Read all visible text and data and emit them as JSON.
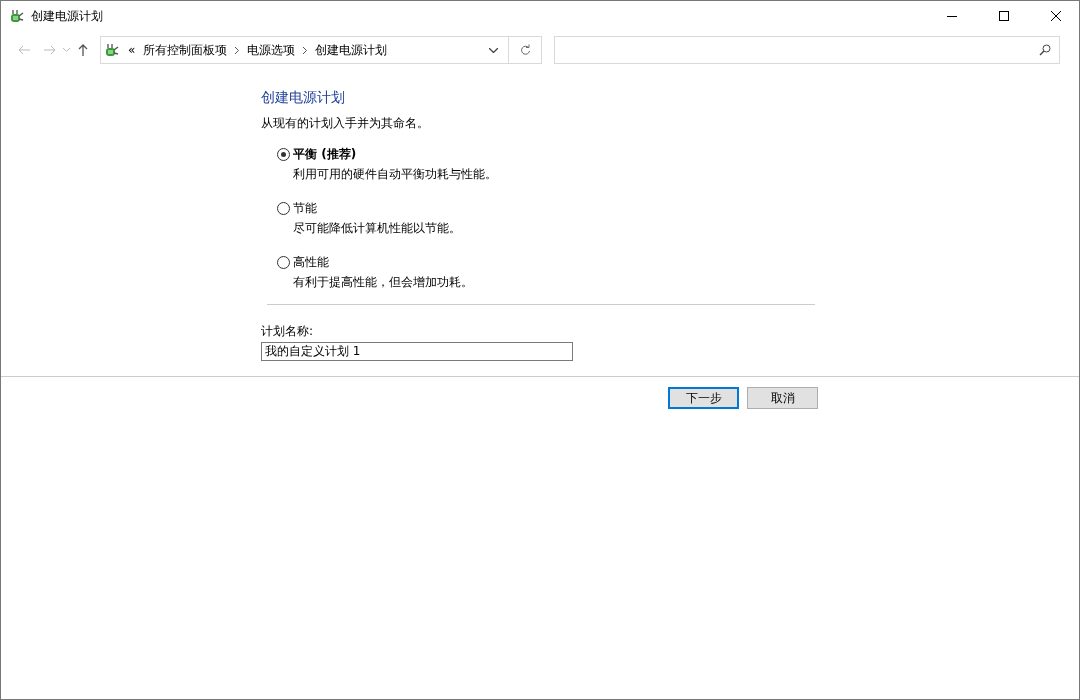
{
  "window": {
    "title": "创建电源计划"
  },
  "address_bar": {
    "overflow": "«",
    "crumbs": [
      "所有控制面板项",
      "电源选项",
      "创建电源计划"
    ]
  },
  "heading": "创建电源计划",
  "intro": "从现有的计划入手并为其命名。",
  "plans": [
    {
      "label": "平衡 (推荐)",
      "description": "利用可用的硬件自动平衡功耗与性能。",
      "selected": true
    },
    {
      "label": "节能",
      "description": "尽可能降低计算机性能以节能。",
      "selected": false
    },
    {
      "label": "高性能",
      "description": "有利于提高性能，但会增加功耗。",
      "selected": false
    }
  ],
  "plan_name": {
    "label": "计划名称:",
    "value": "我的自定义计划 1"
  },
  "buttons": [
    {
      "label": "下一步",
      "default": true
    },
    {
      "label": "取消",
      "default": false
    }
  ]
}
